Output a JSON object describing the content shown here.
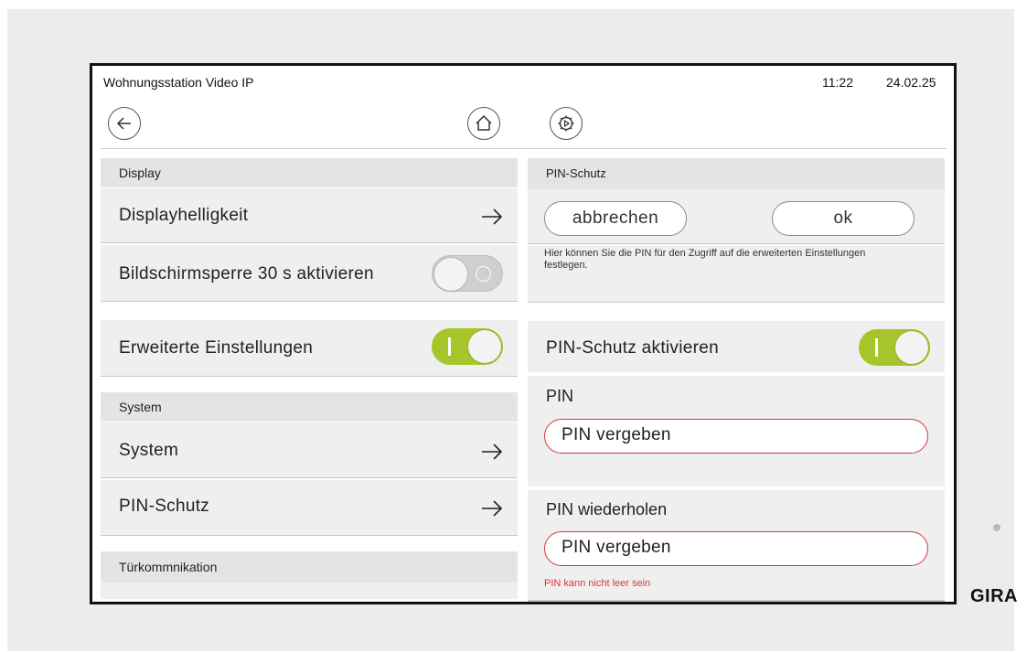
{
  "status": {
    "title": "Wohnungsstation Video IP",
    "time": "11:22",
    "date": "24.02.25"
  },
  "nav": {
    "back_icon": "arrow-left-icon",
    "home_icon": "home-icon",
    "settings_icon": "gear-play-icon"
  },
  "left": {
    "display_header": "Display",
    "brightness_label": "Displayhelligkeit",
    "lock_label": "Bildschirmsperre 30 s aktivieren",
    "lock_toggle_on": false,
    "advanced_label": "Erweiterte Einstellungen",
    "advanced_toggle_on": true,
    "system_header": "System",
    "system_label": "System",
    "pin_label": "PIN-Schutz",
    "door_header": "Türkommnikation"
  },
  "right": {
    "header": "PIN-Schutz",
    "cancel_label": "abbrechen",
    "ok_label": "ok",
    "info_text": "Hier können Sie die PIN für den Zugriff auf die erweiterten Einstellungen festlegen.",
    "activate_label": "PIN-Schutz aktivieren",
    "activate_toggle_on": true,
    "pin_label": "PIN",
    "pin_value": "PIN vergeben",
    "repeat_label": "PIN wiederholen",
    "repeat_value": "PIN vergeben",
    "error_text": "PIN kann nicht leer sein"
  },
  "brand": "GIRA",
  "colors": {
    "toggle_on": "#a6c52a",
    "error": "#d9363e"
  }
}
